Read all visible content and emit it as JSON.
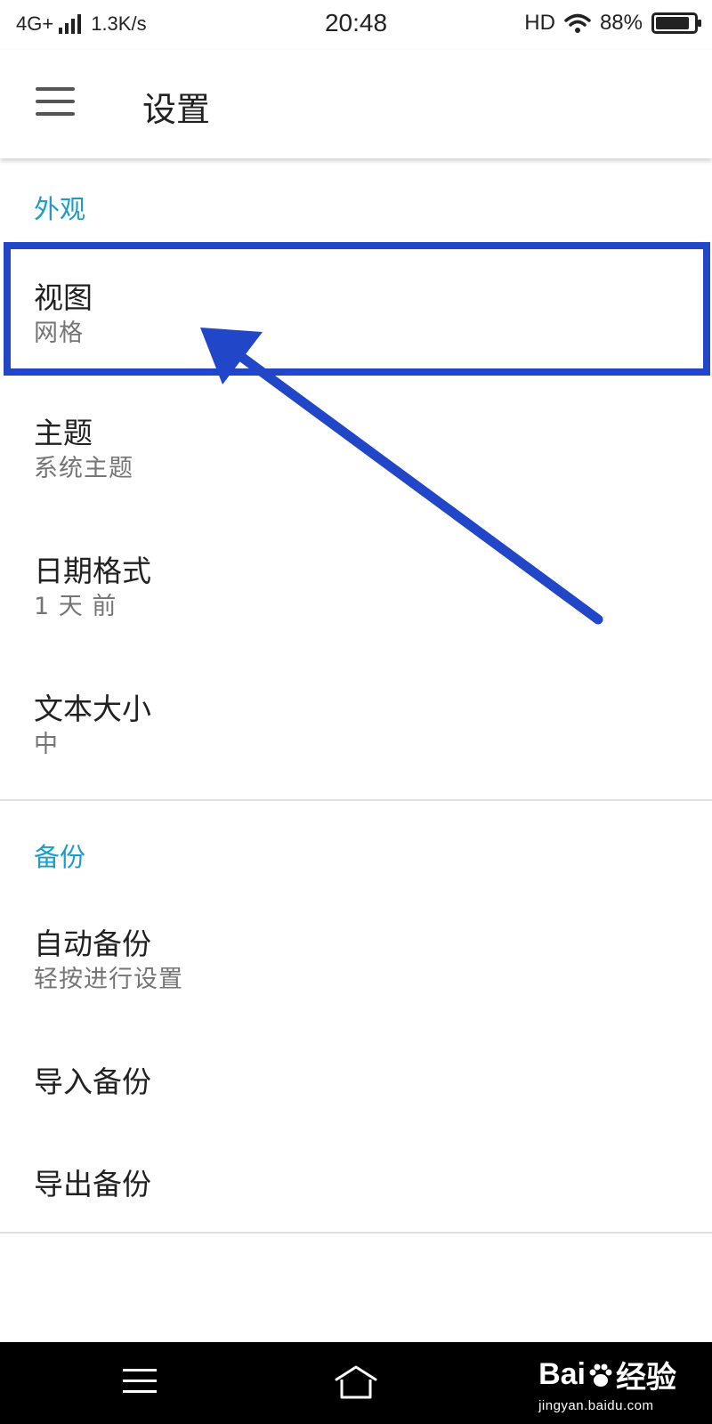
{
  "status_bar": {
    "network": "4G+",
    "speed": "1.3K/s",
    "time": "20:48",
    "hd": "HD",
    "battery": "88%",
    "battery_level": 0.88
  },
  "app_bar": {
    "title": "设置"
  },
  "sections": [
    {
      "header": "外观",
      "items": [
        {
          "title": "视图",
          "subtitle": "网格"
        },
        {
          "title": "主题",
          "subtitle": "系统主题"
        },
        {
          "title": "日期格式",
          "subtitle": "1 天 前"
        },
        {
          "title": "文本大小",
          "subtitle": "中"
        }
      ]
    },
    {
      "header": "备份",
      "items": [
        {
          "title": "自动备份",
          "subtitle": "轻按进行设置"
        },
        {
          "title": "导入备份"
        },
        {
          "title": "导出备份"
        }
      ]
    }
  ],
  "annotation": {
    "color": "#2146c7"
  },
  "accent_color": "#1a9dc9",
  "watermark": {
    "logo_left": "Bai",
    "logo_right": "经验",
    "url": "jingyan.baidu.com"
  }
}
